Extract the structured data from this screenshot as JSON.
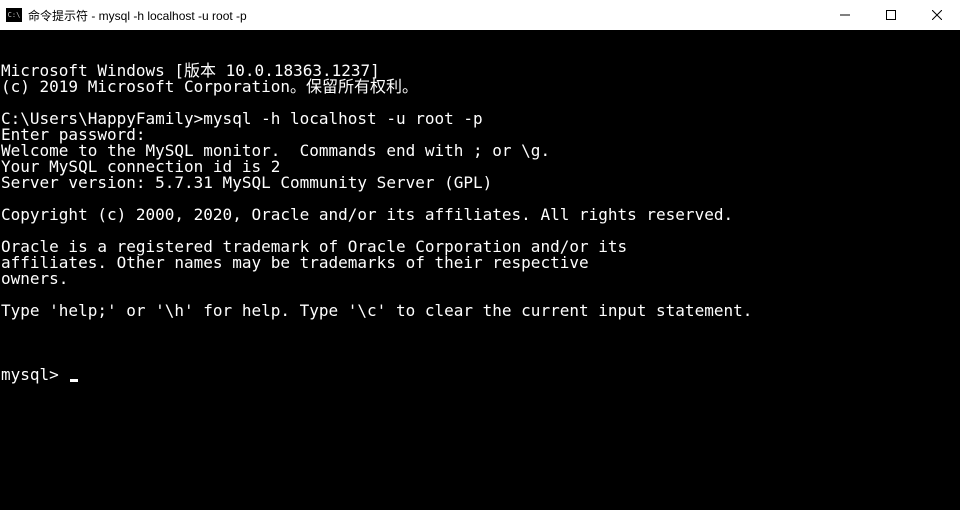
{
  "titlebar": {
    "icon_label": "C:\\",
    "title": "命令提示符 - mysql  -h localhost -u root -p"
  },
  "terminal": {
    "lines": [
      "Microsoft Windows [版本 10.0.18363.1237]",
      "(c) 2019 Microsoft Corporation。保留所有权利。",
      "",
      "C:\\Users\\HappyFamily>mysql -h localhost -u root -p",
      "Enter password:",
      "Welcome to the MySQL monitor.  Commands end with ; or \\g.",
      "Your MySQL connection id is 2",
      "Server version: 5.7.31 MySQL Community Server (GPL)",
      "",
      "Copyright (c) 2000, 2020, Oracle and/or its affiliates. All rights reserved.",
      "",
      "Oracle is a registered trademark of Oracle Corporation and/or its",
      "affiliates. Other names may be trademarks of their respective",
      "owners.",
      "",
      "Type 'help;' or '\\h' for help. Type '\\c' to clear the current input statement.",
      ""
    ],
    "prompt": "mysql> "
  }
}
